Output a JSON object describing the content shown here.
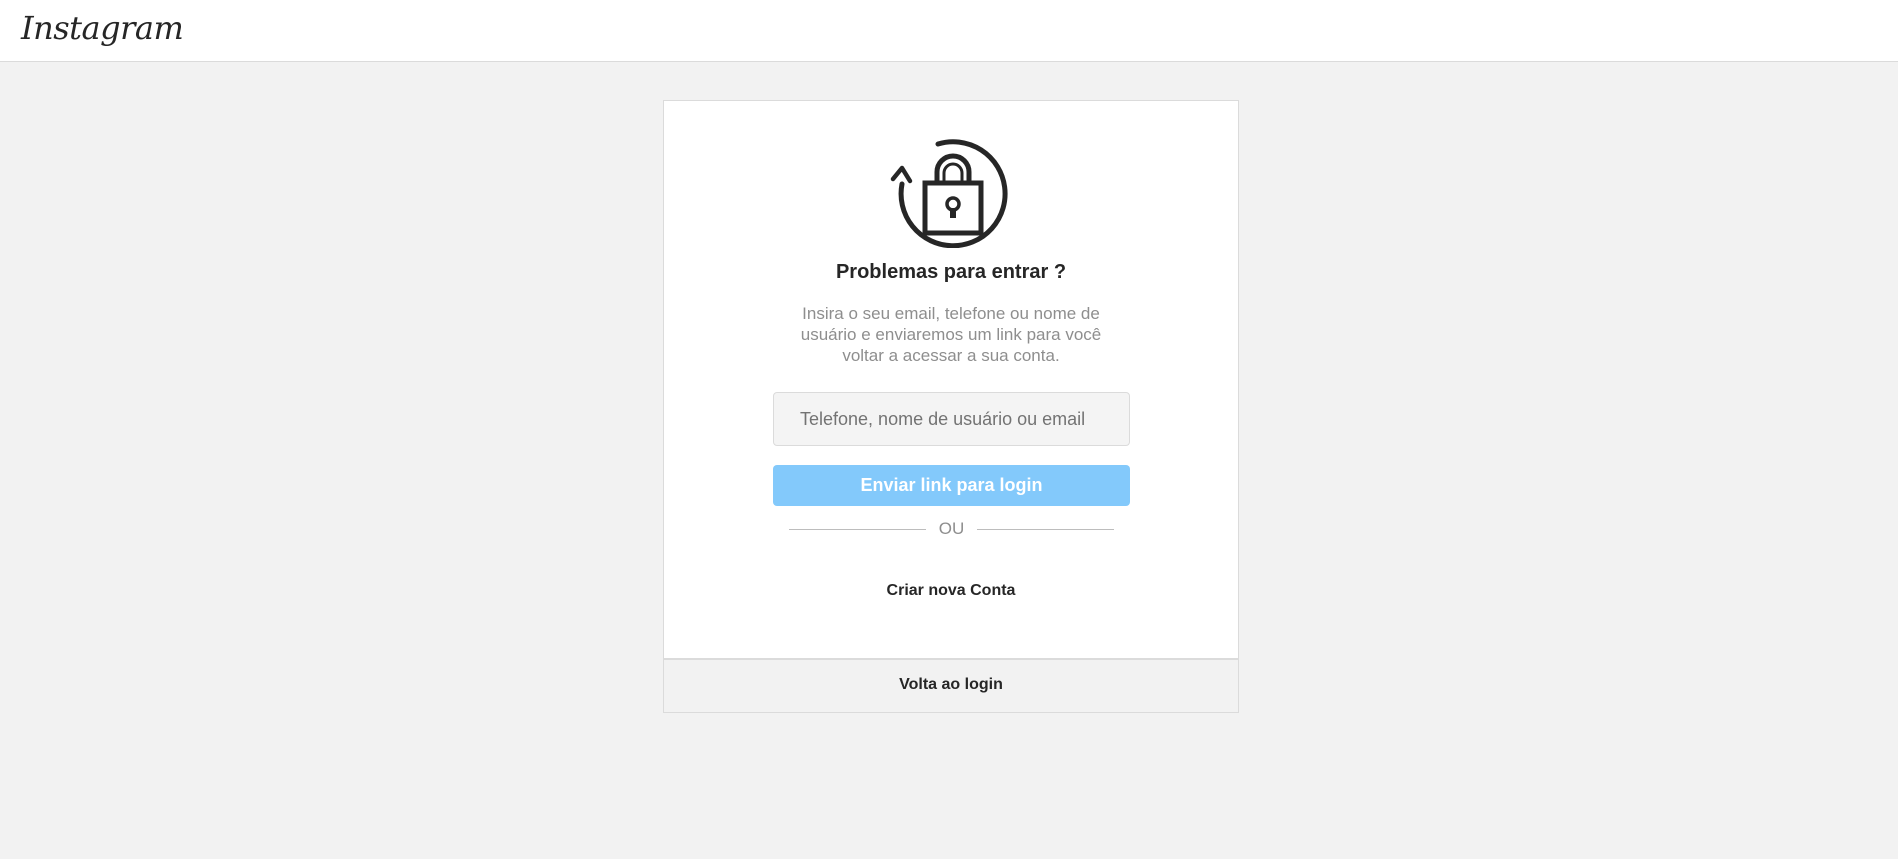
{
  "header": {
    "logo_text": "Instagram"
  },
  "card": {
    "icon": "lock-refresh-icon",
    "title": "Problemas para entrar ?",
    "description": "Insira o seu email, telefone ou nome de usuário e enviaremos um link para você voltar a acessar a sua conta.",
    "input_placeholder": "Telefone, nome de usuário ou email",
    "input_value": "",
    "send_button_label": "Enviar link para login",
    "divider_text": "OU",
    "create_account_label": "Criar nova Conta"
  },
  "footer": {
    "back_to_login_label": "Volta ao login"
  },
  "colors": {
    "background": "#f2f2f2",
    "card": "#ffffff",
    "button": "#83c9fb",
    "text": "#262626",
    "muted": "#8e8e8e"
  }
}
